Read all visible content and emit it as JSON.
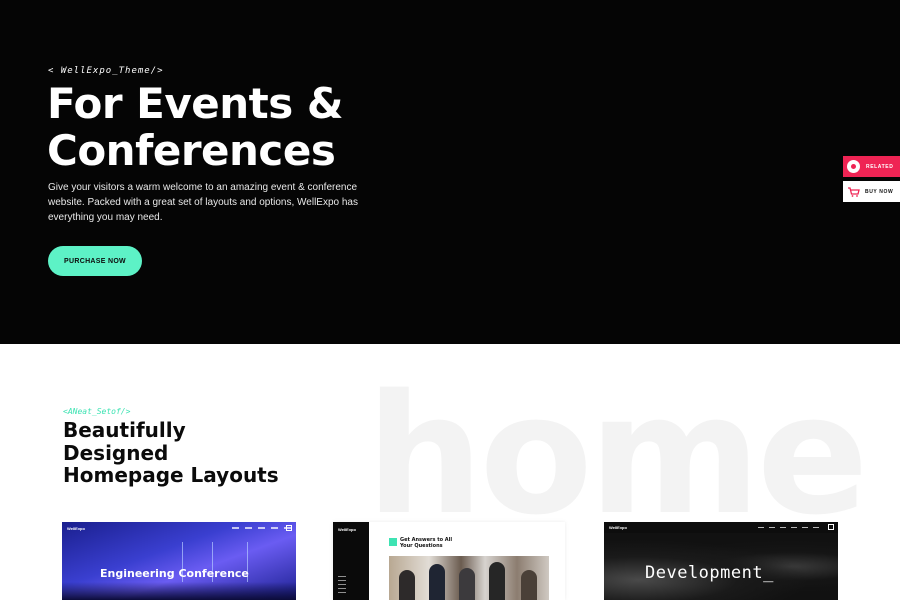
{
  "hero": {
    "tag": "< WellExpo_Theme/>",
    "title": "For Events & Conferences",
    "description": "Give your visitors a warm welcome to an amazing event & conference website. Packed with a great set of layouts and options, WellExpo has everything you may need.",
    "button_label": "PURCHASE NOW",
    "background_color": "#050505",
    "accent_color": "#5df2c6"
  },
  "side_buttons": {
    "related_label": "RELATED",
    "related_icon": "circle-dot-icon",
    "related_color": "#ef2454",
    "buy_label": "BUY NOW",
    "buy_icon": "cart-icon"
  },
  "section": {
    "tag": "<ANeat_Setof/>",
    "title": "Beautifully Designed Homepage Layouts",
    "watermark": "home",
    "tag_color": "#3ee3b3"
  },
  "thumbnails": [
    {
      "logo": "WellExpo",
      "heading": "Engineering Conference"
    },
    {
      "logo": "WellExpo",
      "heading": "Get Answers to All Your Questions"
    },
    {
      "logo": "WellExpo",
      "heading": "Development_"
    }
  ]
}
